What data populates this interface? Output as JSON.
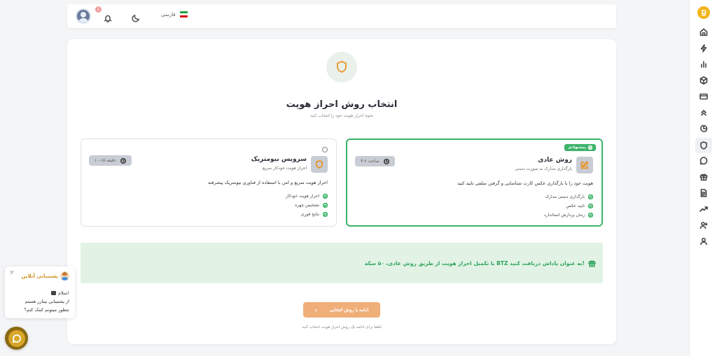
{
  "colors": {
    "accent": "#e8952c",
    "success": "#3cb46a",
    "button": "#f0ae79",
    "reward_bg": "#e2f3e6"
  },
  "topbar": {
    "language": "فارسی",
    "notification_count": "1"
  },
  "page": {
    "title": "انتخاب روش احراز هویت",
    "subtitle": "نحوه احراز هویت خود را انتخاب کنید"
  },
  "options": {
    "normal": {
      "badge": "پیشنهادی",
      "title": "روش عادی",
      "subtitle": "بارگذاری مدارک به صورت دستی",
      "time": "۴-۶ ساعت",
      "description": "هویت خود را با بارگذاری عکس کارت شناسایی و گرفتن سلفی تایید کنید",
      "features": [
        "بارگذاری دستی مدارک",
        "تایید عکس",
        "زمان پردازش استاندارد"
      ],
      "icon": "edit-icon",
      "selected": true
    },
    "biometric": {
      "title": "سرویس بیومتریک",
      "subtitle": "احراز هویت خودکار سریع",
      "time": "۱۰-۱۵ دقیقه",
      "description": "احراز هویت سریع و امن با استفاده از فناوری بیومتریک پیشرفته",
      "features": [
        "احراز هویت خودکار",
        "تشخیص چهره",
        "نتایج فوری"
      ],
      "icon": "shield-icon",
      "selected": false
    }
  },
  "reward": {
    "text": "با تکمیل احراز هویت از طریق روش عادی، ۵۰ سکه BTZ به عنوان پاداش دریافت کنید!"
  },
  "continue_button": {
    "label": "ادامه با روش انتخابی",
    "hint": "لطفا برای ادامه یک روش احراز هویت انتخاب کنید"
  },
  "support": {
    "title": "پشتیبانی آنلاین",
    "greeting": "سلام!",
    "line1": "از پشتیبانی بیتازر هستم",
    "line2": "چطور میتونم کمک کنم؟"
  },
  "sidebar_icons": [
    "home-icon",
    "lightning-icon",
    "chart-icon",
    "box-icon",
    "card-icon",
    "chevrons-up-icon",
    "pie-chart-icon",
    "shield-icon",
    "chat-icon",
    "gift-icon",
    "document-icon",
    "trending-icon",
    "user-plus-icon",
    "user-icon"
  ]
}
